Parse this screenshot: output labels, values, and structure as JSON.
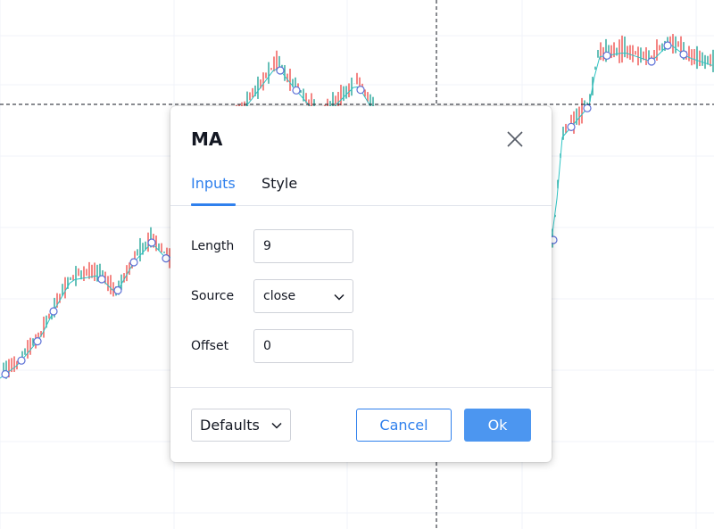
{
  "dialog": {
    "title": "MA",
    "close_icon": "close-icon",
    "tabs": [
      {
        "label": "Inputs",
        "active": true
      },
      {
        "label": "Style",
        "active": false
      }
    ],
    "inputs": {
      "length": {
        "label": "Length",
        "value": "9"
      },
      "source": {
        "label": "Source",
        "value": "close",
        "icon": "chevron-down-icon"
      },
      "offset": {
        "label": "Offset",
        "value": "0"
      }
    },
    "footer": {
      "defaults_label": "Defaults",
      "cancel_label": "Cancel",
      "ok_label": "Ok"
    }
  },
  "colors": {
    "accent": "#2f80ed",
    "ok_button": "#4c96f0",
    "candle_up": "#26a69a",
    "candle_down": "#ef5350",
    "ma_line": "#2ec4c4",
    "ma_marker": "#5b6fd6"
  }
}
